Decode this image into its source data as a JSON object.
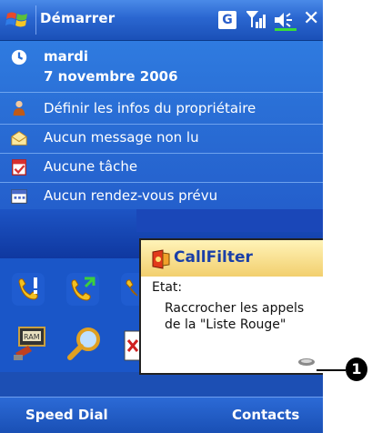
{
  "titlebar": {
    "start_label": "Démarrer",
    "indicator_letter": "G"
  },
  "today": {
    "date_day": "mardi",
    "date_full": "7 novembre 2006",
    "items": [
      {
        "label": "Définir les infos du propriétaire",
        "icon": "owner-icon"
      },
      {
        "label": "Aucun message non lu",
        "icon": "message-icon"
      },
      {
        "label": "Aucune tâche",
        "icon": "task-icon"
      },
      {
        "label": "Aucun rendez-vous prévu",
        "icon": "calendar-icon"
      }
    ]
  },
  "popup": {
    "title": "CallFilter",
    "state_label": "Etat:",
    "message": "Raccrocher les appels de la \"Liste Rouge\""
  },
  "softkeys": {
    "left": "Speed Dial",
    "right": "Contacts"
  },
  "callout": {
    "number": "1"
  },
  "colors": {
    "accent": "#2a6fd6",
    "titlebar": "#2a66d0",
    "popup_title": "#1a3fa8"
  }
}
